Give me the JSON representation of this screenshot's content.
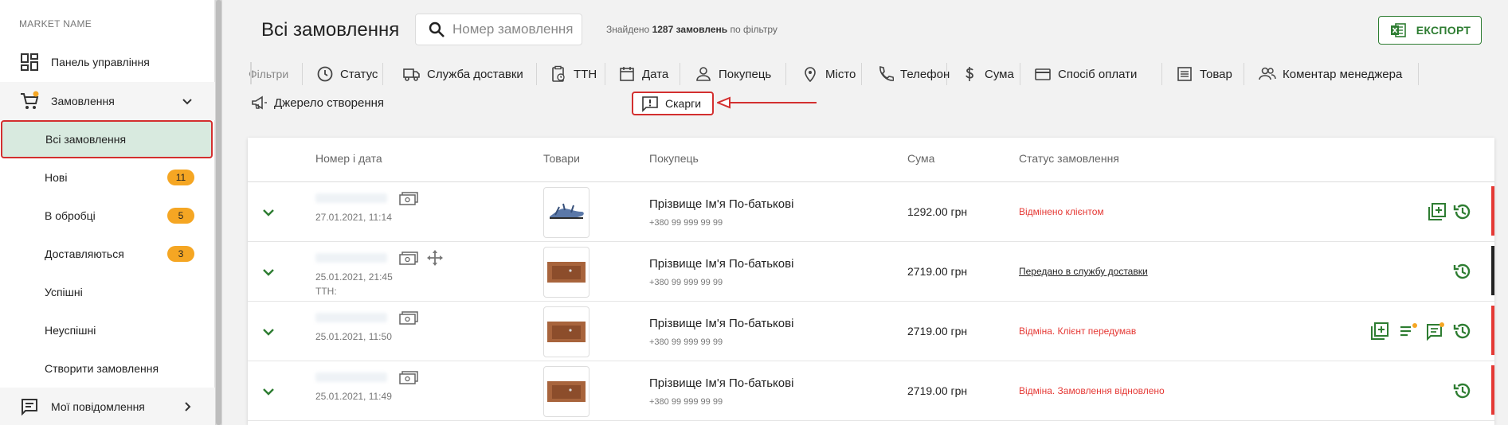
{
  "sidebar": {
    "market_name": "MARKET NAME",
    "items": [
      {
        "label": "Панель управління",
        "icon": "dashboard-icon"
      },
      {
        "label": "Замовлення",
        "icon": "cart-icon"
      },
      {
        "label": "Всі замовлення"
      },
      {
        "label": "Нові",
        "badge": "11"
      },
      {
        "label": "В обробці",
        "badge": "5"
      },
      {
        "label": "Доставляються",
        "badge": "3"
      },
      {
        "label": "Успішні"
      },
      {
        "label": "Неуспішні"
      },
      {
        "label": "Створити замовлення"
      },
      {
        "label": "Мої повідомлення",
        "icon": "messages-icon"
      }
    ]
  },
  "header": {
    "title": "Всі замовлення",
    "search_placeholder": "Номер замовлення",
    "found_prefix": "Знайдено",
    "found_count": "1287 замовлень",
    "found_suffix": "по фільтру",
    "export_label": "ЕКСПОРТ"
  },
  "filters": {
    "label": "Фільтри",
    "items": [
      "Статус",
      "Служба доставки",
      "ТТН",
      "Дата",
      "Покупець",
      "Місто",
      "Телефон",
      "Сума",
      "Спосіб оплати",
      "Товар",
      "Коментар менеджера",
      "Джерело створення",
      "Скарги"
    ]
  },
  "table": {
    "columns": [
      "Номер і дата",
      "Товари",
      "Покупець",
      "Сума",
      "Статус замовлення"
    ],
    "rows": [
      {
        "date": "27.01.2021, 11:14",
        "ttn": "",
        "buyer": "Прізвище Ім'я По-батькові",
        "phone": "+380 99 999 99 99",
        "sum": "1292.00 грн",
        "status": "Відмінено клієнтом"
      },
      {
        "date": "25.01.2021, 21:45",
        "ttn": "ТТН:",
        "buyer": "Прізвище Ім'я По-батькові",
        "phone": "+380 99 999 99 99",
        "sum": "2719.00 грн",
        "status": "Передано в службу доставки"
      },
      {
        "date": "25.01.2021, 11:50",
        "ttn": "",
        "buyer": "Прізвище Ім'я По-батькові",
        "phone": "+380 99 999 99 99",
        "sum": "2719.00 грн",
        "status": "Відміна. Клієнт передумав"
      },
      {
        "date": "25.01.2021, 11:49",
        "ttn": "",
        "buyer": "Прізвище Ім'я По-батькові",
        "phone": "+380 99 999 99 99",
        "sum": "2719.00 грн",
        "status": "Відміна. Замовлення відновлено"
      }
    ]
  },
  "colors": {
    "accent_green": "#2e7d32",
    "highlight_red": "#d32f2f",
    "badge_orange": "#f5a623",
    "active_bg": "#d8eadf"
  }
}
